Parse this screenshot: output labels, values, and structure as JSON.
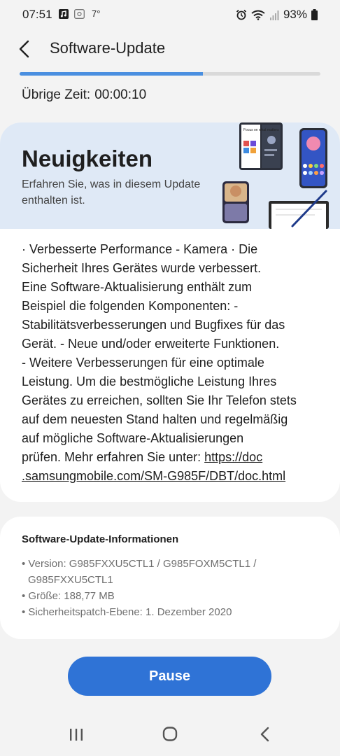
{
  "status_bar": {
    "time": "07:51",
    "temperature": "7°",
    "battery": "93%",
    "icons": [
      "notification-music-icon",
      "notification-image-icon",
      "alarm-icon",
      "wifi-icon",
      "signal-icon",
      "battery-icon"
    ]
  },
  "app_bar": {
    "title": "Software-Update",
    "back_icon": "chevron-left-icon"
  },
  "download": {
    "progress_fraction": 0.61,
    "remaining_label": "Übrige Zeit:",
    "remaining_value": "00:00:10"
  },
  "news": {
    "title": "Neuigkeiten",
    "subtitle": "Erfahren Sie, was in diesem Update enthalten ist.",
    "body_lines": [
      "· Verbesserte Performance - Kamera · Die",
      "Sicherheit Ihres Gerätes wurde verbessert.",
      "Eine Software-Aktualisierung enthält zum",
      "Beispiel die folgenden Komponenten: -",
      "Stabilitätsverbesserungen und Bugfixes für das",
      "Gerät. - Neue und/oder erweiterte Funktionen.",
      "- Weitere Verbesserungen für eine optimale",
      "Leistung. Um die bestmögliche Leistung Ihres",
      "Gerätes zu erreichen, sollten Sie Ihr Telefon stets",
      "auf dem neuesten Stand halten und regelmäßig",
      "auf mögliche Software-Aktualisierungen"
    ],
    "last_line_prefix": "prüfen. Mehr erfahren Sie unter: ",
    "link_part1": "https://doc",
    "link_part2": ".samsungmobile.com/SM-G985F/DBT/doc.html",
    "illustration_text": "Focus on what matters"
  },
  "info": {
    "title": "Software-Update-Informationen",
    "items": [
      "• Version: G985FXXU5CTL1 / G985FOXM5CTL1 / G985FXXU5CTL1",
      "• Größe: 188,77 MB",
      "• Sicherheitspatch-Ebene: 1. Dezember 2020"
    ]
  },
  "actions": {
    "pause_label": "Pause"
  },
  "nav_bar": {
    "icons": [
      "recents-icon",
      "home-icon",
      "back-icon"
    ]
  },
  "colors": {
    "accent": "#2f73d6",
    "progress": "#4a8fe0",
    "header_bg": "#dfe9f6",
    "page_bg": "#f3f3f3"
  }
}
